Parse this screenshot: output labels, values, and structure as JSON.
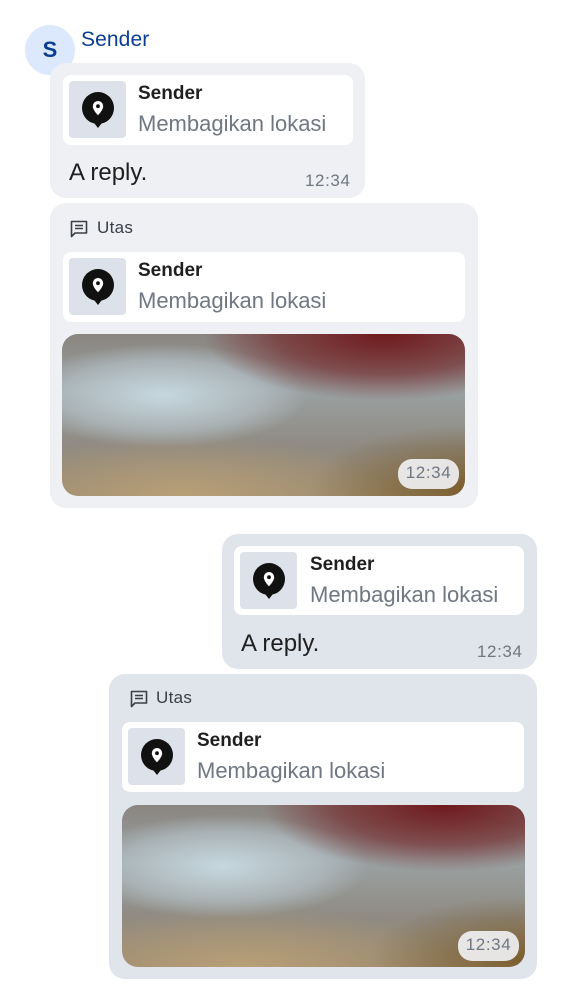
{
  "sender": {
    "name": "Sender",
    "initial": "S"
  },
  "messages": [
    {
      "kind": "incoming-reply",
      "quote": {
        "name": "Sender",
        "text": "Membagikan lokasi"
      },
      "text": "A reply.",
      "time": "12:34"
    },
    {
      "kind": "incoming-thread",
      "thread_label": "Utas",
      "quote": {
        "name": "Sender",
        "text": "Membagikan lokasi"
      },
      "time": "12:34"
    },
    {
      "kind": "outgoing-reply",
      "quote": {
        "name": "Sender",
        "text": "Membagikan lokasi"
      },
      "text": "A reply.",
      "time": "12:34"
    },
    {
      "kind": "outgoing-thread",
      "thread_label": "Utas",
      "quote": {
        "name": "Sender",
        "text": "Membagikan lokasi"
      },
      "time": "12:34"
    }
  ],
  "icons": {
    "avatar": "letter-avatar",
    "location": "location-pin-icon",
    "thread": "thread-icon"
  },
  "colors": {
    "accent": "#0b3d91",
    "incoming_bubble": "#eef0f4",
    "outgoing_bubble": "#e0e4eb"
  }
}
